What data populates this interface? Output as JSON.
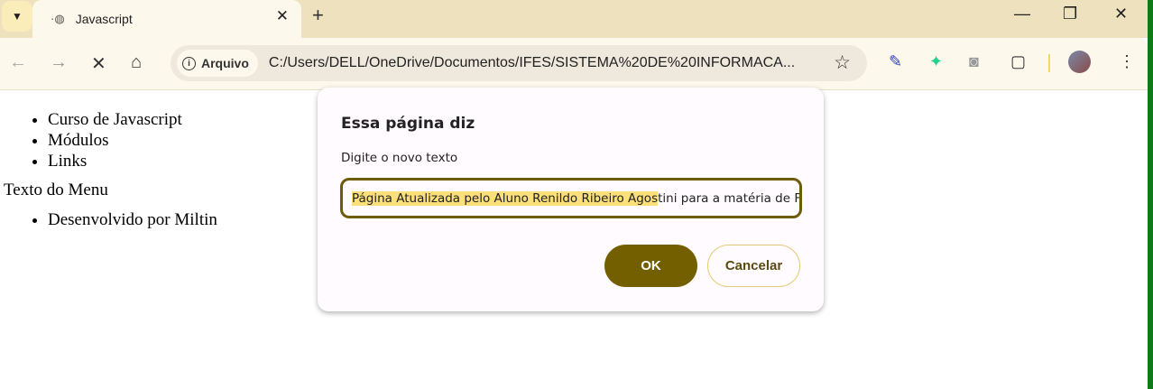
{
  "browser": {
    "tab": {
      "title": "Javascript",
      "favicon": "globe-icon"
    },
    "address": {
      "chip": "Arquivo",
      "url": "C:/Users/DELL/OneDrive/Documentos/IFES/SISTEMA%20DE%20INFORMACA..."
    },
    "icons": [
      "chevron-down-icon",
      "close-icon",
      "plus-icon",
      "minimize-icon",
      "restore-icon",
      "back-icon",
      "forward-icon",
      "stop-icon",
      "home-icon",
      "info-icon",
      "star-icon",
      "eyedropper-icon",
      "extension-icon",
      "camera-icon",
      "puzzle-icon",
      "avatar",
      "more-icon"
    ]
  },
  "page": {
    "menu": [
      "Curso de Javascript",
      "Módulos",
      "Links"
    ],
    "menu_text": "Texto do Menu",
    "footer": [
      "Desenvolvido por Miltin"
    ]
  },
  "dialog": {
    "title": "Essa página diz",
    "message": "Digite o novo texto",
    "input_selected": "Página Atualizada pelo Aluno Renildo Ribeiro Agos",
    "input_rest": "tini para a matéria de F",
    "ok": "OK",
    "cancel": "Cancelar"
  },
  "colors": {
    "accent": "#735f00",
    "selection": "#fbdf78",
    "tabstrip": "#ede2bd"
  }
}
